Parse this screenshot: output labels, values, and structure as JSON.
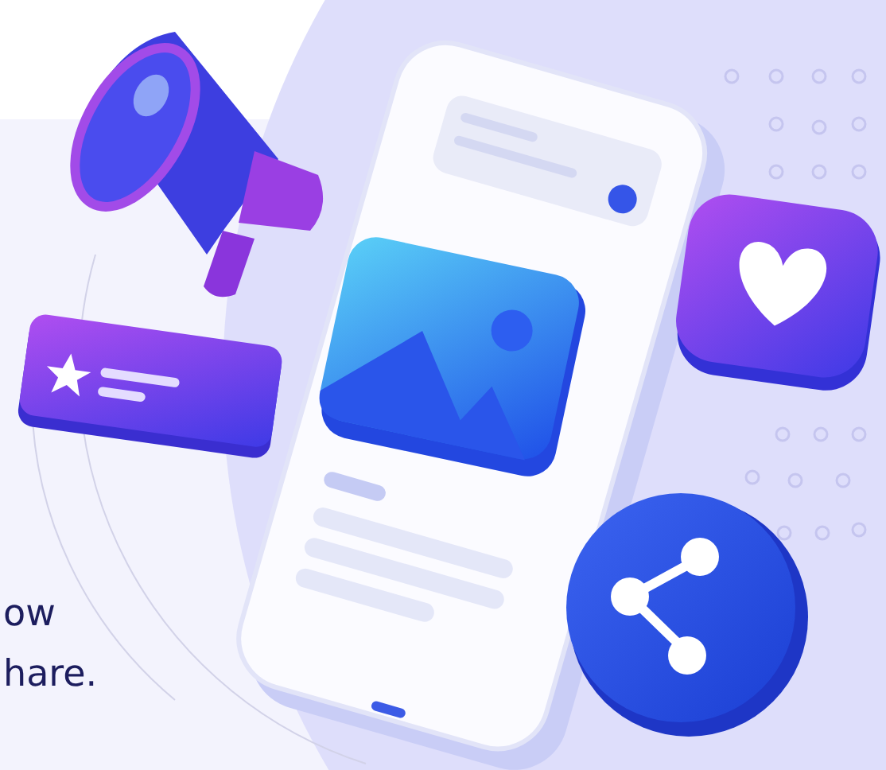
{
  "hero": {
    "text_lines": [
      "ow",
      "hare."
    ]
  }
}
